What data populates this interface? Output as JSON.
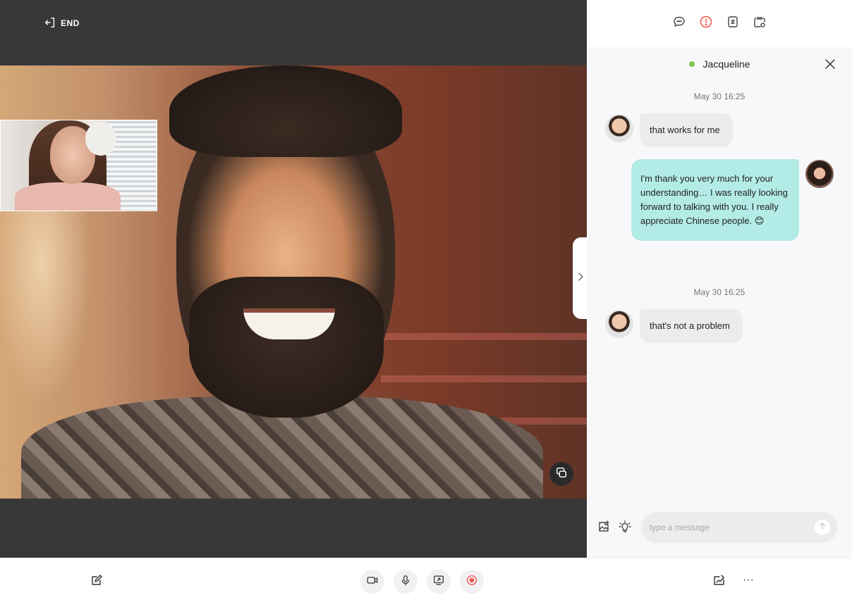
{
  "call": {
    "end_label": "END"
  },
  "chat": {
    "contact_name": "Jacqueline",
    "presence_color": "#7ac74f",
    "timestamps": [
      "May 30 16:25",
      "May 30 16:25"
    ],
    "messages": [
      {
        "direction": "in",
        "text": "that works for me"
      },
      {
        "direction": "out",
        "text": "I'm thank you very much for your understanding… I was really looking forward to talking with you. I really appreciate Chinese people. 😊"
      },
      {
        "direction": "in",
        "text": "that's not a problem"
      }
    ],
    "composer": {
      "placeholder": "type a message",
      "value": ""
    }
  },
  "toolbar_icons": [
    "chat-bubble-icon",
    "info-icon",
    "document-icon",
    "clipboard-icon"
  ],
  "colors": {
    "accent_red": "#f2534a",
    "outgoing_bubble": "#b3ebe6",
    "incoming_bubble": "#ececee",
    "video_bg": "#383838"
  },
  "bottom_controls": [
    "notes-icon",
    "camera-icon",
    "microphone-icon",
    "screen-share-icon",
    "record-icon",
    "whiteboard-icon",
    "more-icon"
  ],
  "more_label": "···"
}
